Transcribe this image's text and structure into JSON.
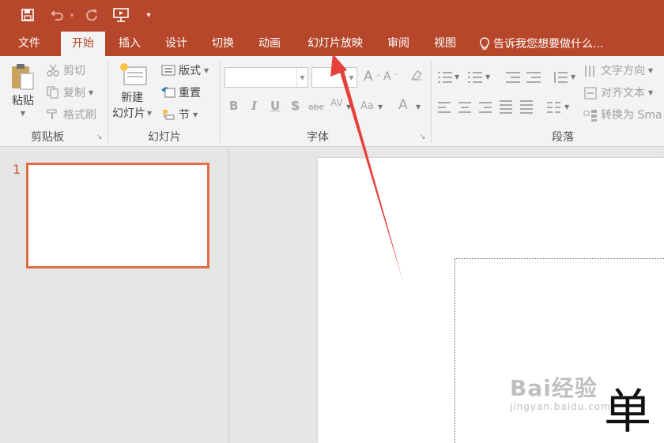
{
  "quick_access": {
    "save_icon": "save-icon",
    "undo_icon": "undo-icon",
    "redo_icon": "redo-icon",
    "start_from_beginning_icon": "slideshow-from-start-icon",
    "customize_icon": "customize-qat-icon"
  },
  "tabs": [
    "文件",
    "开始",
    "插入",
    "设计",
    "切换",
    "动画",
    "幻灯片放映",
    "审阅",
    "视图"
  ],
  "active_tab": "开始",
  "tell_me": "告诉我您想要做什么...",
  "clipboard": {
    "paste": "粘贴",
    "cut": "剪切",
    "copy": "复制",
    "format_painter": "格式刷",
    "label": "剪贴板"
  },
  "slides": {
    "new_slide_line1": "新建",
    "new_slide_line2": "幻灯片",
    "layout": "版式",
    "reset": "重置",
    "section": "节",
    "label": "幻灯片"
  },
  "font": {
    "font_name_value": "",
    "font_size_value": "",
    "grow_font": "A",
    "shrink_font": "A",
    "bold": "B",
    "italic": "I",
    "underline": "U",
    "shadow": "S",
    "strikethrough": "abc",
    "char_spacing": "AV",
    "change_case": "Aa",
    "font_color": "A",
    "label": "字体"
  },
  "paragraph": {
    "text_direction": "文字方向",
    "align_text": "对齐文本",
    "convert_smartart": "转换为 Sma",
    "label": "段落"
  },
  "thumbnails": {
    "slide_number": "1"
  },
  "watermark": {
    "logo": "Bai经验",
    "url": "jingyan.baidu.com"
  },
  "overlay_glyph": "单",
  "colors": {
    "accent": "#b7472a",
    "thumb_border": "#e46c47",
    "arrow": "#e5403a"
  }
}
